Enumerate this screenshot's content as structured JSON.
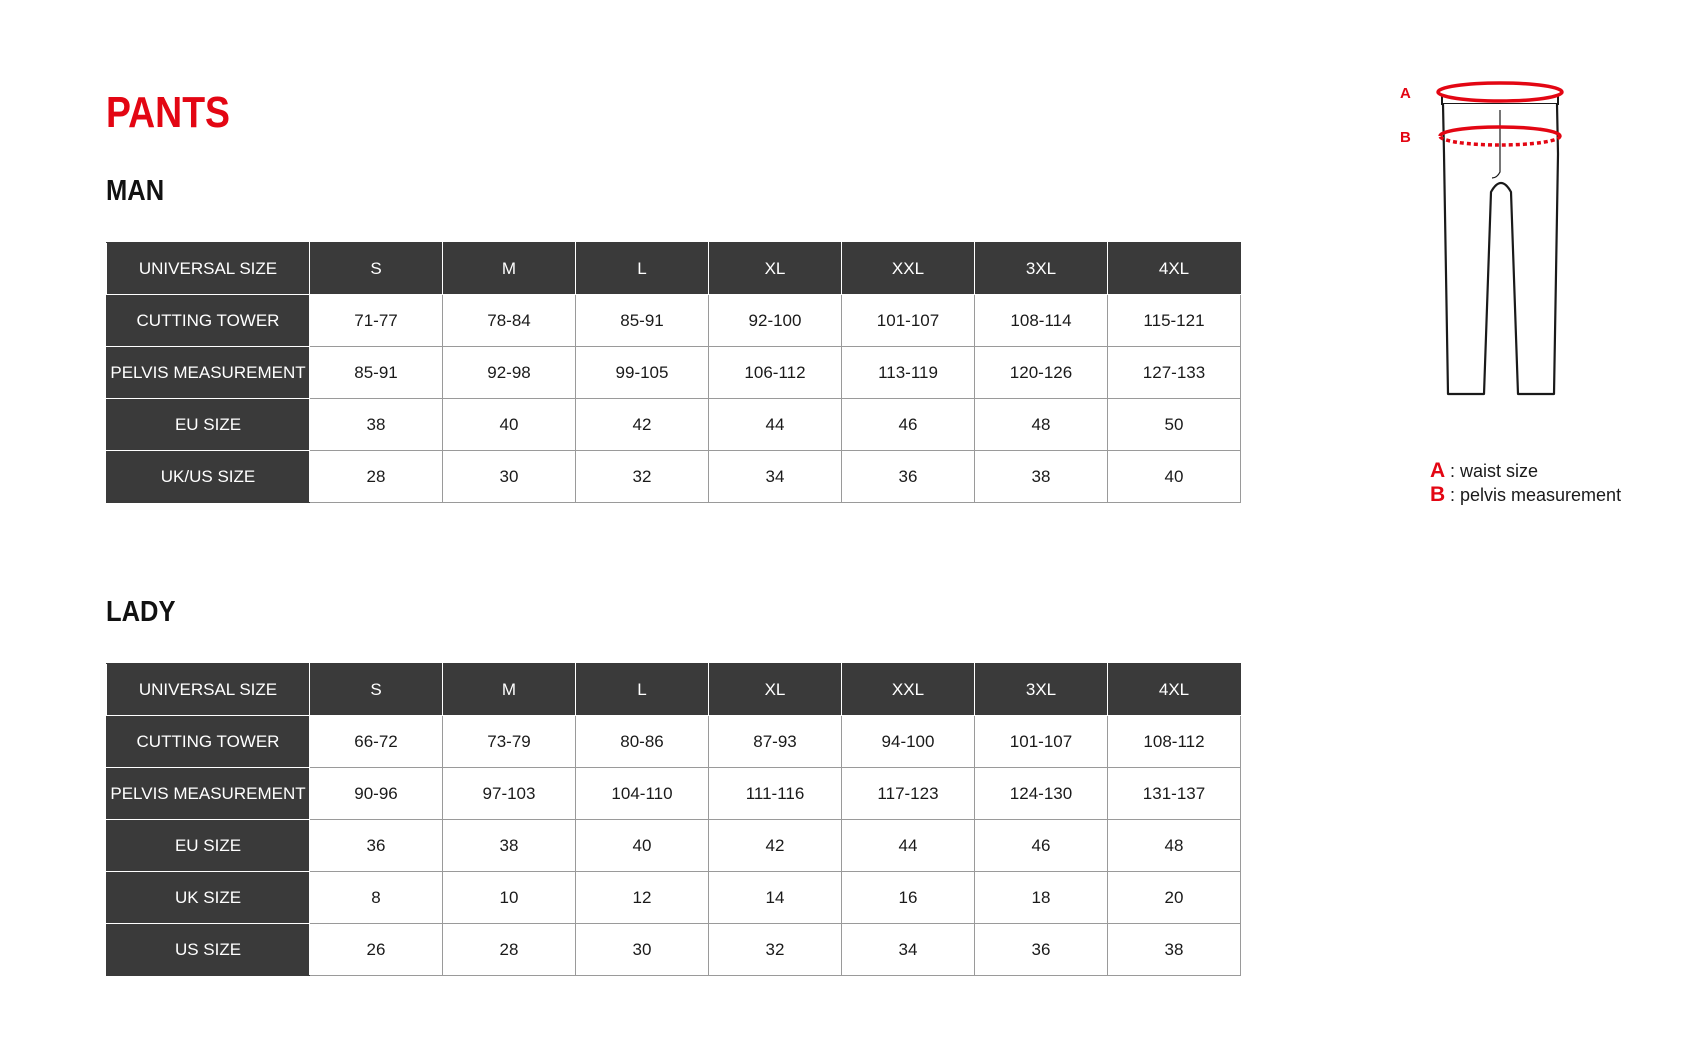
{
  "title": "PANTS",
  "colors": {
    "accent": "#e30613",
    "header_bg": "#3a3a3a",
    "header_text": "#ffffff",
    "border": "#9a9a9a"
  },
  "man": {
    "title": "MAN",
    "header": [
      "UNIVERSAL SIZE",
      "S",
      "M",
      "L",
      "XL",
      "XXL",
      "3XL",
      "4XL"
    ],
    "rows": [
      {
        "label": "CUTTING TOWER",
        "values": [
          "71-77",
          "78-84",
          "85-91",
          "92-100",
          "101-107",
          "108-114",
          "115-121"
        ]
      },
      {
        "label": "PELVIS MEASUREMENT",
        "values": [
          "85-91",
          "92-98",
          "99-105",
          "106-112",
          "113-119",
          "120-126",
          "127-133"
        ]
      },
      {
        "label": "EU SIZE",
        "values": [
          "38",
          "40",
          "42",
          "44",
          "46",
          "48",
          "50"
        ]
      },
      {
        "label": "UK/US SIZE",
        "values": [
          "28",
          "30",
          "32",
          "34",
          "36",
          "38",
          "40"
        ]
      }
    ]
  },
  "lady": {
    "title": "LADY",
    "header": [
      "UNIVERSAL SIZE",
      "S",
      "M",
      "L",
      "XL",
      "XXL",
      "3XL",
      "4XL"
    ],
    "rows": [
      {
        "label": "CUTTING TOWER",
        "values": [
          "66-72",
          "73-79",
          "80-86",
          "87-93",
          "94-100",
          "101-107",
          "108-112"
        ]
      },
      {
        "label": "PELVIS MEASUREMENT",
        "values": [
          "90-96",
          "97-103",
          "104-110",
          "111-116",
          "117-123",
          "124-130",
          "131-137"
        ]
      },
      {
        "label": "EU SIZE",
        "values": [
          "36",
          "38",
          "40",
          "42",
          "44",
          "46",
          "48"
        ]
      },
      {
        "label": "UK SIZE",
        "values": [
          "8",
          "10",
          "12",
          "14",
          "16",
          "18",
          "20"
        ]
      },
      {
        "label": "US SIZE",
        "values": [
          "26",
          "28",
          "30",
          "32",
          "34",
          "36",
          "38"
        ]
      }
    ]
  },
  "diagram": {
    "icon": "pants-diagram-icon",
    "marker_a": "A",
    "marker_b": "B"
  },
  "legend": [
    {
      "letter": "A",
      "text": ": waist size"
    },
    {
      "letter": "B",
      "text": ": pelvis measurement"
    }
  ]
}
